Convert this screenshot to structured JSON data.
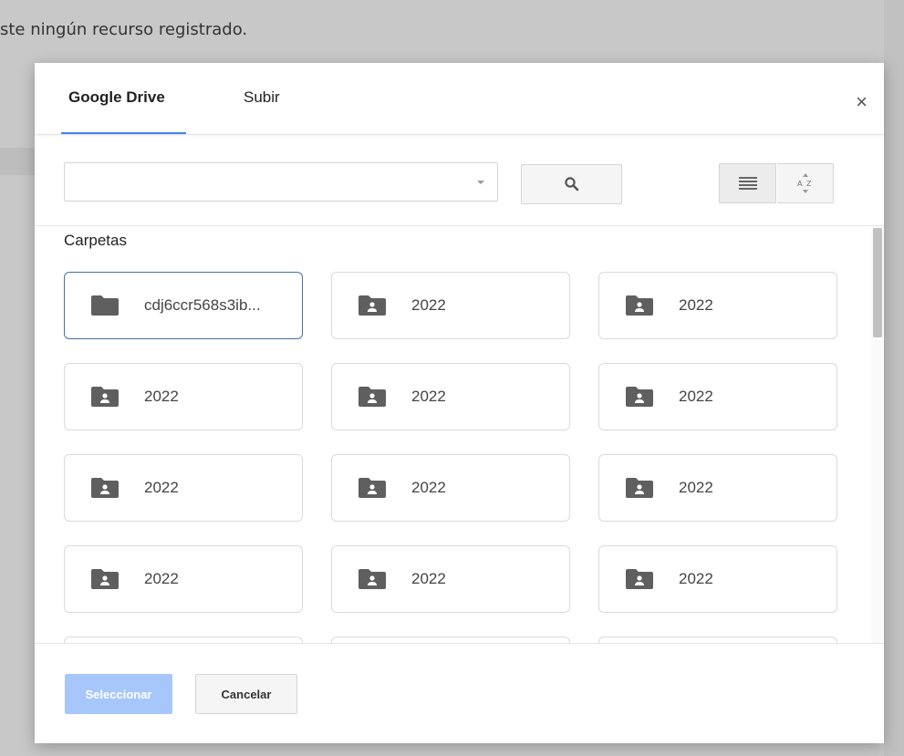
{
  "background": {
    "text": "ste ningún recurso registrado."
  },
  "dialog": {
    "tabs": [
      {
        "label": "Google Drive",
        "active": true
      },
      {
        "label": "Subir",
        "active": false
      }
    ],
    "close_label": "×",
    "search": {
      "value": "",
      "placeholder": ""
    },
    "section_title": "Carpetas",
    "folders": [
      {
        "name": "cdj6ccr568s3ib...",
        "icon": "folder-icon",
        "selected": true
      },
      {
        "name": "2022",
        "icon": "shared-folder-icon"
      },
      {
        "name": "2022",
        "icon": "shared-folder-icon"
      },
      {
        "name": "2022",
        "icon": "shared-folder-icon"
      },
      {
        "name": "2022",
        "icon": "shared-folder-icon"
      },
      {
        "name": "2022",
        "icon": "shared-folder-icon"
      },
      {
        "name": "2022",
        "icon": "shared-folder-icon"
      },
      {
        "name": "2022",
        "icon": "shared-folder-icon"
      },
      {
        "name": "2022",
        "icon": "shared-folder-icon"
      },
      {
        "name": "2022",
        "icon": "shared-folder-icon"
      },
      {
        "name": "2022",
        "icon": "shared-folder-icon"
      },
      {
        "name": "2022",
        "icon": "shared-folder-icon"
      },
      {
        "name": "",
        "icon": ""
      },
      {
        "name": "",
        "icon": ""
      },
      {
        "name": "",
        "icon": ""
      }
    ],
    "footer": {
      "select_label": "Seleccionar",
      "cancel_label": "Cancelar"
    }
  },
  "colors": {
    "accent": "#4285f4",
    "select_button": "#a7c7fb",
    "selected_border": "#4a6fa5",
    "icon": "#5f5f5f"
  }
}
